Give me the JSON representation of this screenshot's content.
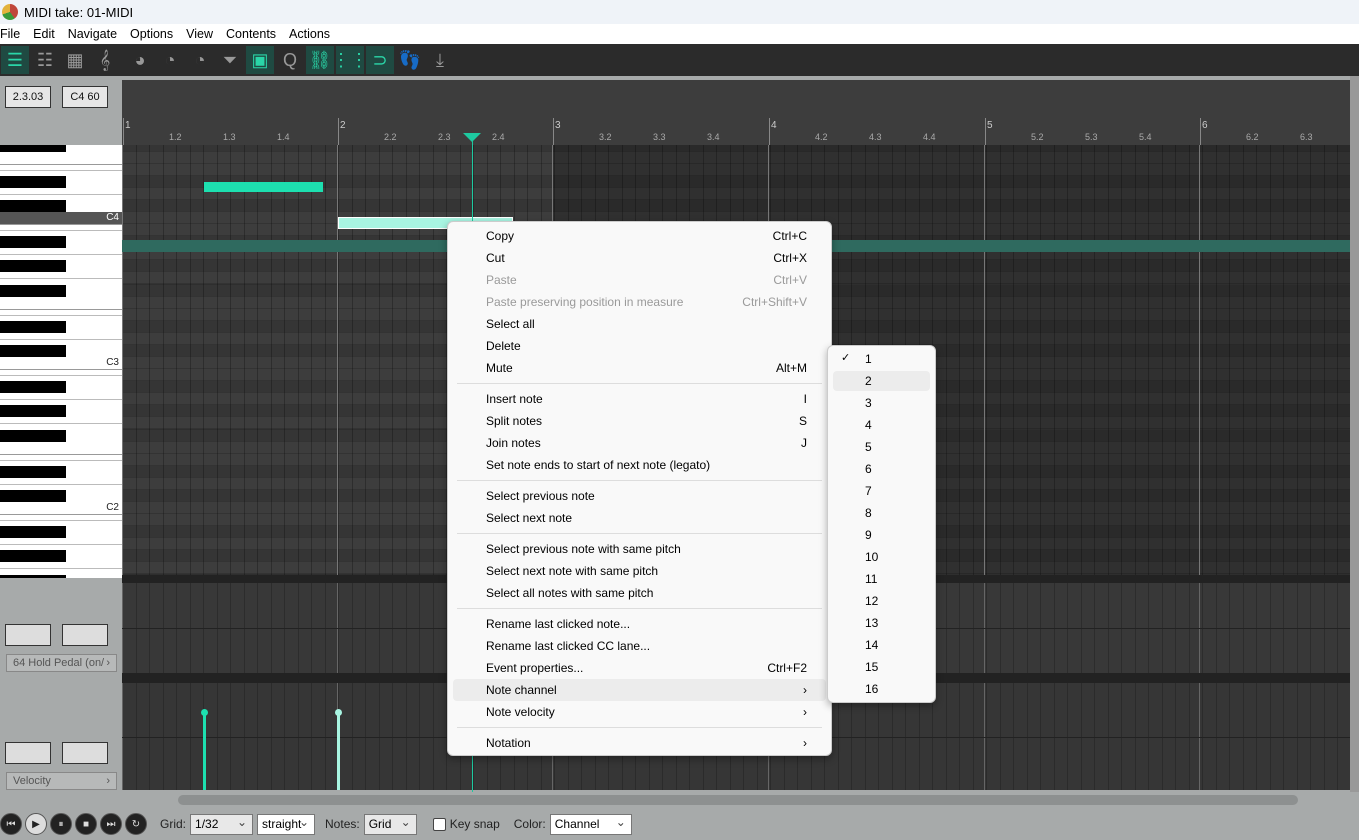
{
  "window": {
    "title": "MIDI take: 01-MIDI"
  },
  "menu": [
    "File",
    "Edit",
    "Navigate",
    "Options",
    "View",
    "Contents",
    "Actions"
  ],
  "toolbar": [
    {
      "icon": "piano-roll-icon",
      "active": true
    },
    {
      "icon": "named-notes-icon",
      "active": false
    },
    {
      "icon": "event-list-icon",
      "active": false
    },
    {
      "icon": "notation-icon",
      "active": false
    },
    {
      "icon": "insert-note-palette-icon",
      "active": false
    },
    {
      "icon": "play-palette-icon",
      "active": false
    },
    {
      "icon": "diamond-palette-icon",
      "active": false
    },
    {
      "icon": "filter-icon",
      "active": false
    },
    {
      "icon": "cc-lanes-icon",
      "active": true
    },
    {
      "icon": "quantize-icon",
      "active": false
    },
    {
      "icon": "link-icon",
      "active": true
    },
    {
      "icon": "grid-icon",
      "active": true
    },
    {
      "icon": "loop-icon",
      "active": true
    },
    {
      "icon": "step-input-icon",
      "active": false
    },
    {
      "icon": "import-icon",
      "active": false
    }
  ],
  "position": "2.3.03",
  "pitch": "C4  60",
  "ruler": {
    "measures": [
      "1",
      "2",
      "3",
      "4",
      "5",
      "6"
    ],
    "beats": [
      "1.2",
      "1.3",
      "1.4",
      "2.2",
      "2.3",
      "2.4",
      "3.2",
      "3.3",
      "3.4",
      "4.2",
      "4.3",
      "4.4",
      "5.2",
      "5.3",
      "5.4",
      "6.2",
      "6.3"
    ]
  },
  "piano_labels": [
    "C4",
    "C3",
    "C2"
  ],
  "cc_lane": {
    "label": "64 Hold Pedal (on/"
  },
  "velocity_lane": {
    "label": "Velocity"
  },
  "context_menu": [
    {
      "label": "Copy",
      "shortcut": "Ctrl+C"
    },
    {
      "label": "Cut",
      "shortcut": "Ctrl+X"
    },
    {
      "label": "Paste",
      "shortcut": "Ctrl+V",
      "disabled": true
    },
    {
      "label": "Paste preserving position in measure",
      "shortcut": "Ctrl+Shift+V",
      "disabled": true
    },
    {
      "label": "Select all"
    },
    {
      "label": "Delete"
    },
    {
      "label": "Mute",
      "shortcut": "Alt+M"
    },
    {
      "sep": true
    },
    {
      "label": "Insert note",
      "shortcut": "I"
    },
    {
      "label": "Split notes",
      "shortcut": "S"
    },
    {
      "label": "Join notes",
      "shortcut": "J"
    },
    {
      "label": "Set note ends to start of next note (legato)"
    },
    {
      "sep": true
    },
    {
      "label": "Select previous note"
    },
    {
      "label": "Select next note"
    },
    {
      "sep": true
    },
    {
      "label": "Select previous note with same pitch"
    },
    {
      "label": "Select next note with same pitch"
    },
    {
      "label": "Select all notes with same pitch"
    },
    {
      "sep": true
    },
    {
      "label": "Rename last clicked note..."
    },
    {
      "label": "Rename last clicked CC lane..."
    },
    {
      "label": "Event properties...",
      "shortcut": "Ctrl+F2"
    },
    {
      "label": "Note channel",
      "shortcut": "›",
      "highlighted": true
    },
    {
      "label": "Note velocity",
      "shortcut": "›"
    },
    {
      "sep": true
    },
    {
      "label": "Notation",
      "shortcut": "›"
    }
  ],
  "channel_submenu": {
    "items": [
      "1",
      "2",
      "3",
      "4",
      "5",
      "6",
      "7",
      "8",
      "9",
      "10",
      "11",
      "12",
      "13",
      "14",
      "15",
      "16"
    ],
    "checked": "1",
    "hovered": "2",
    "check_mark": "✓"
  },
  "bottom": {
    "transport": [
      "rewind",
      "play",
      "pause",
      "stop",
      "forward",
      "repeat"
    ],
    "grid_label": "Grid:",
    "grid_value": "1/32",
    "swing_value": "straight",
    "notes_label": "Notes:",
    "notes_value": "Grid",
    "key_snap_label": "Key snap",
    "key_snap": false,
    "color_label": "Color:",
    "color_value": "Channel"
  },
  "colors": {
    "note": "#1de0b0",
    "selected_note": "#a8f5e2",
    "playhead": "#1ec9a0"
  }
}
